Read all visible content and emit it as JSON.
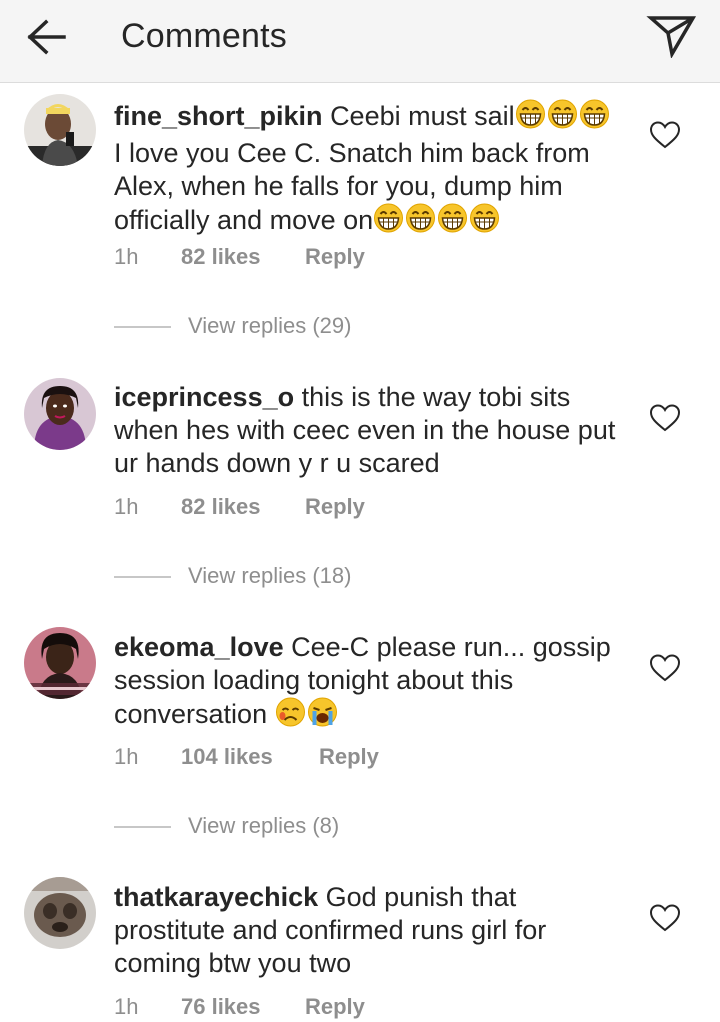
{
  "header": {
    "back_icon": "arrow-left-icon",
    "title": "Comments",
    "send_icon": "paper-plane-icon"
  },
  "colors": {
    "text": "#262626",
    "secondary": "#8e8e8e",
    "header_bg": "#f5f5f5"
  },
  "comments": [
    {
      "username": "fine_short_pikin",
      "text": "Ceebi must sail",
      "emoji_1": "😁😁😁",
      "text_2": "I love you Cee C. Snatch him back from Alex, when he falls for you, dump him officially and move on",
      "emoji_2": "😁😁😁😁",
      "time": "1h",
      "likes": "82 likes",
      "reply": "Reply",
      "view_replies": "View replies (29)"
    },
    {
      "username": "iceprincess_o",
      "text": "this is the way tobi sits when hes with ceec even in the house   put ur hands down y r u scared",
      "time": "1h",
      "likes": "82 likes",
      "reply": "Reply",
      "view_replies": "View replies (18)"
    },
    {
      "username": "ekeoma_love",
      "text": "Cee-C please run... gossip session loading tonight about this conversation",
      "emoji": "😥😭",
      "time": "1h",
      "likes": "104 likes",
      "reply": "Reply",
      "view_replies": "View replies (8)"
    },
    {
      "username": "thatkarayechick",
      "text": "God punish that prostitute and confirmed runs girl for coming btw you two",
      "time": "1h",
      "likes": "76 likes",
      "reply": "Reply"
    }
  ]
}
